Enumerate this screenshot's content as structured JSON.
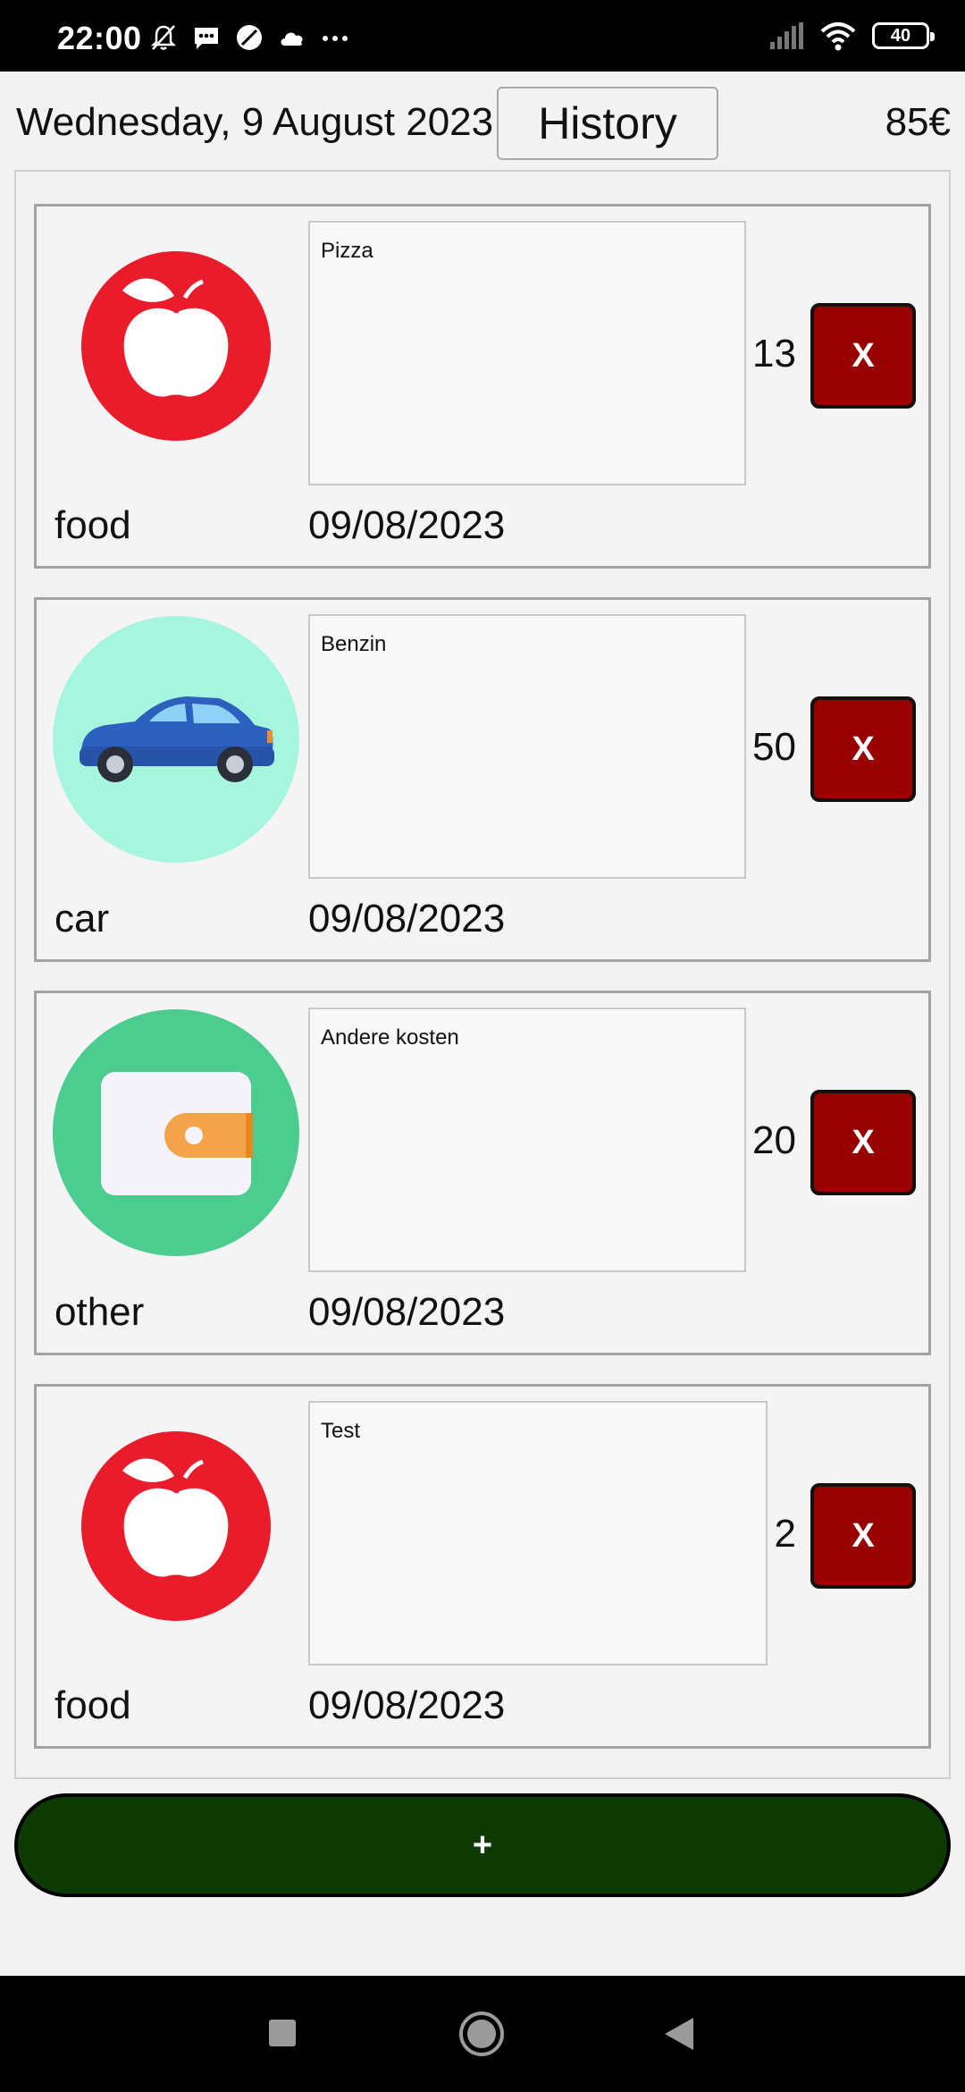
{
  "status_bar": {
    "time": "22:00",
    "left_icons": [
      "mute-icon",
      "message-icon",
      "no-disturb-icon",
      "cloud-icon",
      "more-dots-icon"
    ],
    "right_icons": [
      "signal-icon",
      "wifi-icon"
    ],
    "battery_level": "40"
  },
  "header": {
    "date": "Wednesday, 9 August 2023",
    "history_label": "History",
    "total": "85€"
  },
  "expenses": [
    {
      "category": "food",
      "icon": "apple-icon",
      "note": "Pizza",
      "date": "09/08/2023",
      "amount": "13",
      "delete_label": "X"
    },
    {
      "category": "car",
      "icon": "car-icon",
      "note": "Benzin",
      "date": "09/08/2023",
      "amount": "50",
      "delete_label": "X"
    },
    {
      "category": "other",
      "icon": "wallet-icon",
      "note": "Andere kosten",
      "date": "09/08/2023",
      "amount": "20",
      "delete_label": "X"
    },
    {
      "category": "food",
      "icon": "apple-icon",
      "note": "Test",
      "date": "09/08/2023",
      "amount": "2",
      "delete_label": "X"
    }
  ],
  "add_button_label": "+",
  "nav_bar": {
    "icons": [
      "recents-square-icon",
      "home-circle-icon",
      "back-triangle-icon"
    ]
  },
  "colors": {
    "delete_button": "#990000",
    "add_button": "#0c3a00",
    "food_icon": "#e81c2a",
    "car_icon_bg": "#a6f5df",
    "car_body": "#2d5fbf",
    "wallet_icon_bg": "#4ccc8e",
    "wallet_tab": "#f3a44b"
  }
}
